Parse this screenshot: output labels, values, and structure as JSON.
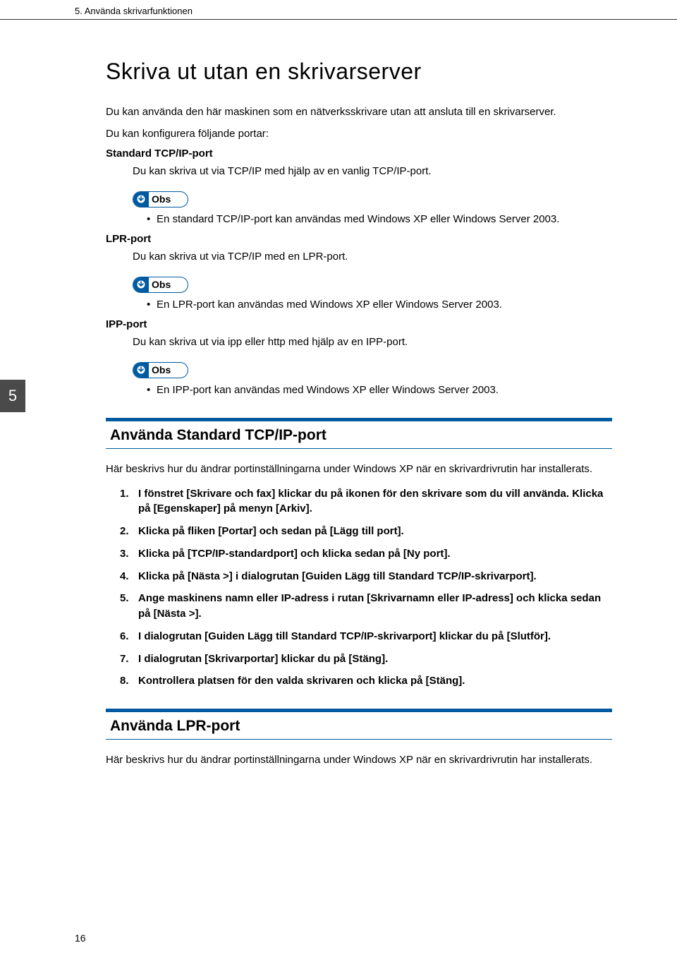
{
  "header": {
    "chapter": "5. Använda skrivarfunktionen"
  },
  "tab": "5",
  "title": "Skriva ut utan en skrivarserver",
  "intro1": "Du kan använda den här maskinen som en nätverksskrivare utan att ansluta till en skrivarserver.",
  "intro2": "Du kan konfigurera följande portar:",
  "note_label": "Obs",
  "ports": {
    "standard": {
      "label": "Standard TCP/IP-port",
      "desc": "Du kan skriva ut via TCP/IP med hjälp av en vanlig TCP/IP-port.",
      "note": "En standard TCP/IP-port kan användas med Windows XP eller Windows Server 2003."
    },
    "lpr": {
      "label": "LPR-port",
      "desc": "Du kan skriva ut via TCP/IP med en LPR-port.",
      "note": "En LPR-port kan användas med Windows XP eller Windows Server 2003."
    },
    "ipp": {
      "label": "IPP-port",
      "desc": "Du kan skriva ut via ipp eller http med hjälp av en IPP-port.",
      "note": "En IPP-port kan användas med Windows XP eller Windows Server 2003."
    }
  },
  "section1": {
    "heading": "Använda Standard TCP/IP-port",
    "desc": "Här beskrivs hur du ändrar portinställningarna under Windows XP när en skrivardrivrutin har installerats.",
    "steps": [
      "I fönstret [Skrivare och fax] klickar du på ikonen för den skrivare som du vill använda. Klicka på [Egenskaper] på menyn [Arkiv].",
      "Klicka på fliken [Portar] och sedan på [Lägg till port].",
      "Klicka på [TCP/IP-standardport] och klicka sedan på [Ny port].",
      "Klicka på [Nästa >] i dialogrutan [Guiden Lägg till Standard TCP/IP-skrivarport].",
      "Ange maskinens namn eller IP-adress i rutan [Skrivarnamn eller IP-adress] och klicka sedan på [Nästa >].",
      "I dialogrutan [Guiden Lägg till Standard TCP/IP-skrivarport] klickar du på [Slutför].",
      "I dialogrutan [Skrivarportar] klickar du på [Stäng].",
      "Kontrollera platsen för den valda skrivaren och klicka på [Stäng]."
    ]
  },
  "section2": {
    "heading": "Använda LPR-port",
    "desc": "Här beskrivs hur du ändrar portinställningarna under Windows XP när en skrivardrivrutin har installerats."
  },
  "page_number": "16"
}
